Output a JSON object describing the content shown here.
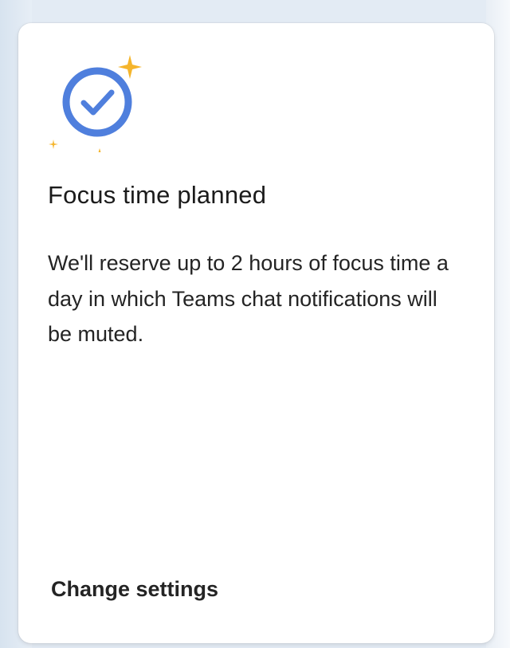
{
  "card": {
    "title": "Focus time planned",
    "description": "We'll reserve up to 2 hours of focus time a day in which Teams chat notifications will be muted.",
    "action_label": "Change settings"
  },
  "icons": {
    "main": "check-circle-icon",
    "decoration": "sparkle-icon"
  },
  "colors": {
    "check_circle": "#4f7fdd",
    "sparkle": "#f5b52c",
    "background": "#e3ebf4",
    "card": "#ffffff"
  }
}
